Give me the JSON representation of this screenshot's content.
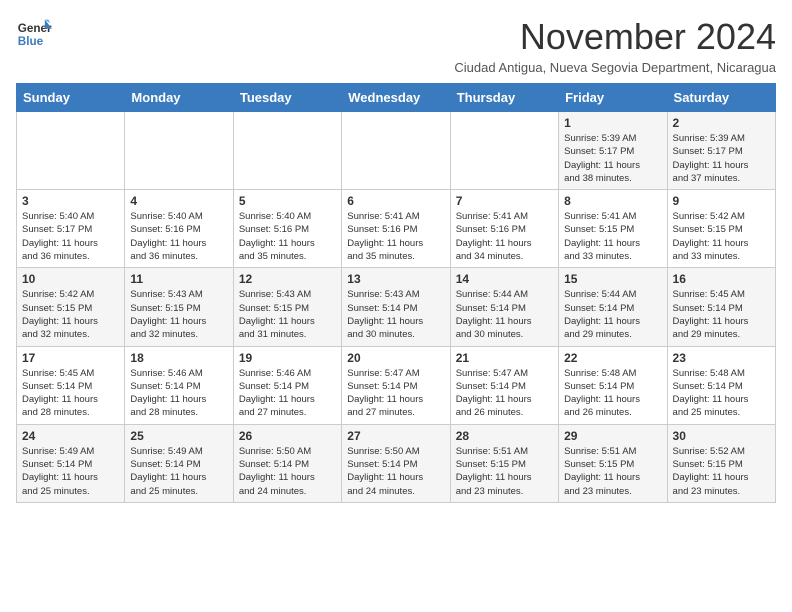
{
  "logo": {
    "line1": "General",
    "line2": "Blue"
  },
  "title": "November 2024",
  "subtitle": "Ciudad Antigua, Nueva Segovia Department, Nicaragua",
  "days_of_week": [
    "Sunday",
    "Monday",
    "Tuesday",
    "Wednesday",
    "Thursday",
    "Friday",
    "Saturday"
  ],
  "weeks": [
    [
      {
        "day": "",
        "info": ""
      },
      {
        "day": "",
        "info": ""
      },
      {
        "day": "",
        "info": ""
      },
      {
        "day": "",
        "info": ""
      },
      {
        "day": "",
        "info": ""
      },
      {
        "day": "1",
        "info": "Sunrise: 5:39 AM\nSunset: 5:17 PM\nDaylight: 11 hours\nand 38 minutes."
      },
      {
        "day": "2",
        "info": "Sunrise: 5:39 AM\nSunset: 5:17 PM\nDaylight: 11 hours\nand 37 minutes."
      }
    ],
    [
      {
        "day": "3",
        "info": "Sunrise: 5:40 AM\nSunset: 5:17 PM\nDaylight: 11 hours\nand 36 minutes."
      },
      {
        "day": "4",
        "info": "Sunrise: 5:40 AM\nSunset: 5:16 PM\nDaylight: 11 hours\nand 36 minutes."
      },
      {
        "day": "5",
        "info": "Sunrise: 5:40 AM\nSunset: 5:16 PM\nDaylight: 11 hours\nand 35 minutes."
      },
      {
        "day": "6",
        "info": "Sunrise: 5:41 AM\nSunset: 5:16 PM\nDaylight: 11 hours\nand 35 minutes."
      },
      {
        "day": "7",
        "info": "Sunrise: 5:41 AM\nSunset: 5:16 PM\nDaylight: 11 hours\nand 34 minutes."
      },
      {
        "day": "8",
        "info": "Sunrise: 5:41 AM\nSunset: 5:15 PM\nDaylight: 11 hours\nand 33 minutes."
      },
      {
        "day": "9",
        "info": "Sunrise: 5:42 AM\nSunset: 5:15 PM\nDaylight: 11 hours\nand 33 minutes."
      }
    ],
    [
      {
        "day": "10",
        "info": "Sunrise: 5:42 AM\nSunset: 5:15 PM\nDaylight: 11 hours\nand 32 minutes."
      },
      {
        "day": "11",
        "info": "Sunrise: 5:43 AM\nSunset: 5:15 PM\nDaylight: 11 hours\nand 32 minutes."
      },
      {
        "day": "12",
        "info": "Sunrise: 5:43 AM\nSunset: 5:15 PM\nDaylight: 11 hours\nand 31 minutes."
      },
      {
        "day": "13",
        "info": "Sunrise: 5:43 AM\nSunset: 5:14 PM\nDaylight: 11 hours\nand 30 minutes."
      },
      {
        "day": "14",
        "info": "Sunrise: 5:44 AM\nSunset: 5:14 PM\nDaylight: 11 hours\nand 30 minutes."
      },
      {
        "day": "15",
        "info": "Sunrise: 5:44 AM\nSunset: 5:14 PM\nDaylight: 11 hours\nand 29 minutes."
      },
      {
        "day": "16",
        "info": "Sunrise: 5:45 AM\nSunset: 5:14 PM\nDaylight: 11 hours\nand 29 minutes."
      }
    ],
    [
      {
        "day": "17",
        "info": "Sunrise: 5:45 AM\nSunset: 5:14 PM\nDaylight: 11 hours\nand 28 minutes."
      },
      {
        "day": "18",
        "info": "Sunrise: 5:46 AM\nSunset: 5:14 PM\nDaylight: 11 hours\nand 28 minutes."
      },
      {
        "day": "19",
        "info": "Sunrise: 5:46 AM\nSunset: 5:14 PM\nDaylight: 11 hours\nand 27 minutes."
      },
      {
        "day": "20",
        "info": "Sunrise: 5:47 AM\nSunset: 5:14 PM\nDaylight: 11 hours\nand 27 minutes."
      },
      {
        "day": "21",
        "info": "Sunrise: 5:47 AM\nSunset: 5:14 PM\nDaylight: 11 hours\nand 26 minutes."
      },
      {
        "day": "22",
        "info": "Sunrise: 5:48 AM\nSunset: 5:14 PM\nDaylight: 11 hours\nand 26 minutes."
      },
      {
        "day": "23",
        "info": "Sunrise: 5:48 AM\nSunset: 5:14 PM\nDaylight: 11 hours\nand 25 minutes."
      }
    ],
    [
      {
        "day": "24",
        "info": "Sunrise: 5:49 AM\nSunset: 5:14 PM\nDaylight: 11 hours\nand 25 minutes."
      },
      {
        "day": "25",
        "info": "Sunrise: 5:49 AM\nSunset: 5:14 PM\nDaylight: 11 hours\nand 25 minutes."
      },
      {
        "day": "26",
        "info": "Sunrise: 5:50 AM\nSunset: 5:14 PM\nDaylight: 11 hours\nand 24 minutes."
      },
      {
        "day": "27",
        "info": "Sunrise: 5:50 AM\nSunset: 5:14 PM\nDaylight: 11 hours\nand 24 minutes."
      },
      {
        "day": "28",
        "info": "Sunrise: 5:51 AM\nSunset: 5:15 PM\nDaylight: 11 hours\nand 23 minutes."
      },
      {
        "day": "29",
        "info": "Sunrise: 5:51 AM\nSunset: 5:15 PM\nDaylight: 11 hours\nand 23 minutes."
      },
      {
        "day": "30",
        "info": "Sunrise: 5:52 AM\nSunset: 5:15 PM\nDaylight: 11 hours\nand 23 minutes."
      }
    ]
  ]
}
